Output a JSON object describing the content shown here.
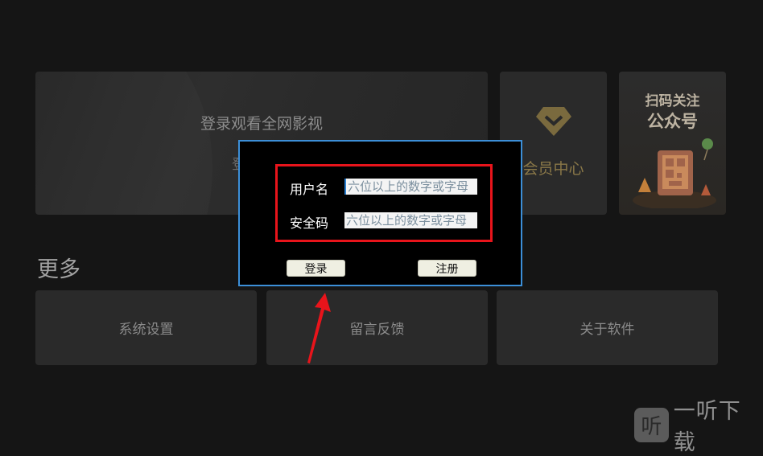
{
  "home": {
    "login_card": {
      "title": "登录观看全网影视",
      "subtitle": "登录/注册"
    },
    "member_card": {
      "label": "会员中心"
    },
    "qr_card": {
      "line1": "扫码关注",
      "line2": "公众号"
    },
    "more": {
      "title": "更多",
      "items": [
        {
          "label": "系统设置"
        },
        {
          "label": "留言反馈"
        },
        {
          "label": "关于软件"
        }
      ]
    }
  },
  "dialog": {
    "username": {
      "label": "用户名",
      "placeholder": "六位以上的数字或字母"
    },
    "security_code": {
      "label": "安全码",
      "placeholder": "六位以上的数字或字母"
    },
    "login_button": "登录",
    "register_button": "注册"
  },
  "watermark": {
    "badge": "听",
    "text": "一听下载"
  },
  "colors": {
    "background": "#151515",
    "card": "#2a2a2a",
    "dialog_border": "#3c8fd8",
    "highlight_red": "#e8141b",
    "member_gold": "#8a7848"
  }
}
